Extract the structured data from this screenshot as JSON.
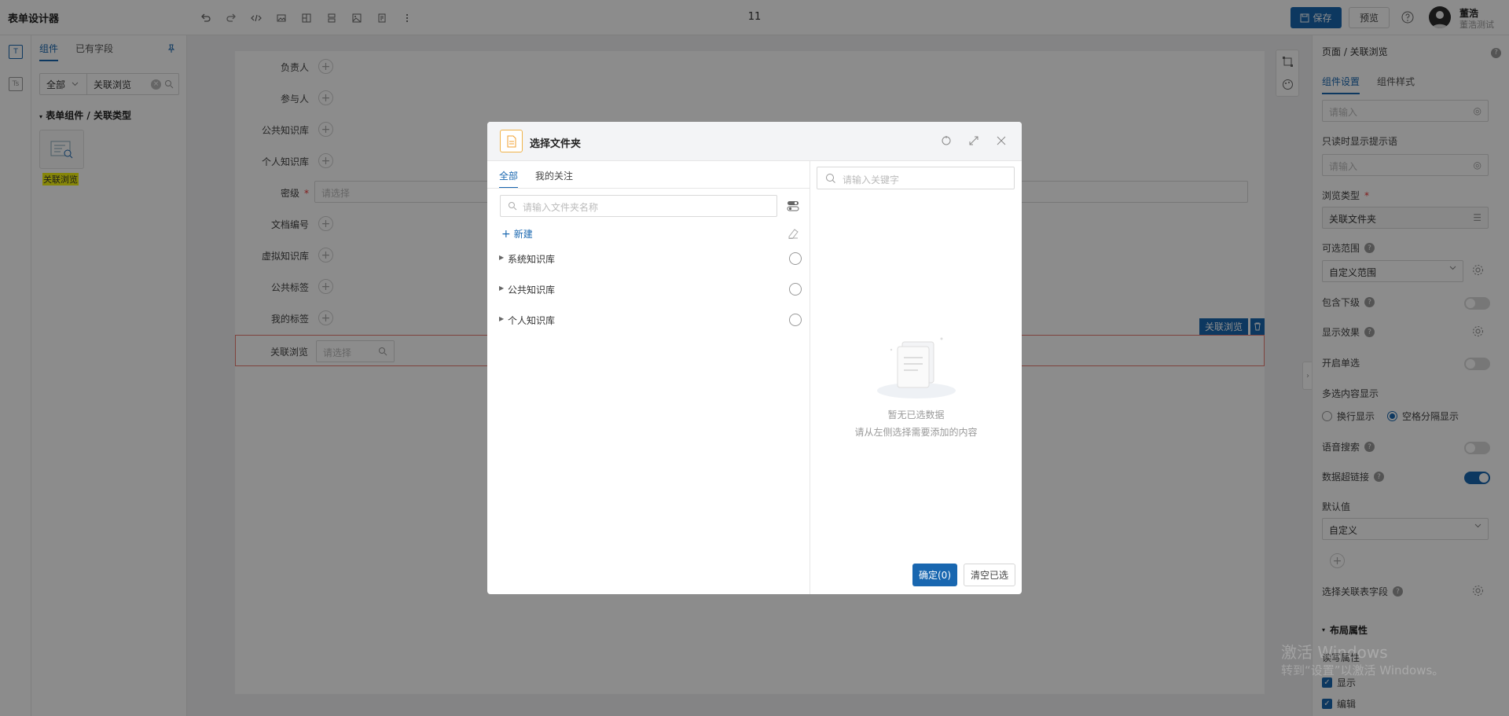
{
  "app": {
    "title": "表单设计器",
    "center_count": "11"
  },
  "toolbar": {
    "save_label": "保存",
    "preview_label": "预览"
  },
  "user": {
    "name": "董浩",
    "subtitle": "董浩测试"
  },
  "rail": {
    "icon1": "T",
    "icon2": "Ts"
  },
  "left_panel": {
    "tabs": [
      "组件",
      "已有字段"
    ],
    "filter_select": "全部",
    "filter_text": "关联浏览",
    "group_title": "表单组件 / 关联类型",
    "component_label": "关联浏览"
  },
  "form": {
    "rows": [
      {
        "label": "负责人"
      },
      {
        "label": "参与人"
      },
      {
        "label": "公共知识库"
      },
      {
        "label": "个人知识库"
      },
      {
        "label": "密级",
        "placeholder": "请选择"
      },
      {
        "label": "文档编号"
      },
      {
        "label": "虚拟知识库"
      },
      {
        "label": "公共标签"
      },
      {
        "label": "我的标签"
      },
      {
        "label": "关联浏览",
        "placeholder": "请选择"
      }
    ],
    "selected_tag": "关联浏览"
  },
  "right_panel": {
    "breadcrumb": "页面 / 关联浏览",
    "tabs": [
      "组件设置",
      "组件样式"
    ],
    "input1_placeholder": "请输入",
    "readonly_hint_label": "只读时显示提示语",
    "input2_placeholder": "请输入",
    "browse_type_label": "浏览类型",
    "browse_type_value": "关联文件夹",
    "range_label": "可选范围",
    "range_value": "自定义范围",
    "include_sub_label": "包含下级",
    "display_effect_label": "显示效果",
    "single_select_label": "开启单选",
    "multi_display_label": "多选内容显示",
    "multi_options": [
      "换行显示",
      "空格分隔显示"
    ],
    "voice_search_label": "语音搜索",
    "hyperlink_label": "数据超链接",
    "default_label": "默认值",
    "default_value": "自定义",
    "related_field_label": "选择关联表字段",
    "layout_title": "布局属性",
    "rw_label": "读写属性",
    "check_show": "显示",
    "check_edit": "编辑",
    "toggles": {
      "include_sub": false,
      "single_select": false,
      "voice_search": false,
      "hyperlink": true
    }
  },
  "modal": {
    "title": "选择文件夹",
    "tabs": [
      "全部",
      "我的关注"
    ],
    "search_placeholder": "请输入文件夹名称",
    "new_label": "新建",
    "tree": [
      "系统知识库",
      "公共知识库",
      "个人知识库"
    ],
    "right_search_placeholder": "请输入关键字",
    "empty_title": "暂无已选数据",
    "empty_desc": "请从左侧选择需要添加的内容",
    "confirm_label": "确定(0)",
    "clear_label": "清空已选"
  },
  "watermark": {
    "line1": "激活 Windows",
    "line2": "转到“设置”以激活 Windows。"
  },
  "colors": {
    "primary": "#1967b0",
    "required": "#e33333",
    "highlight": "#f5f510"
  }
}
